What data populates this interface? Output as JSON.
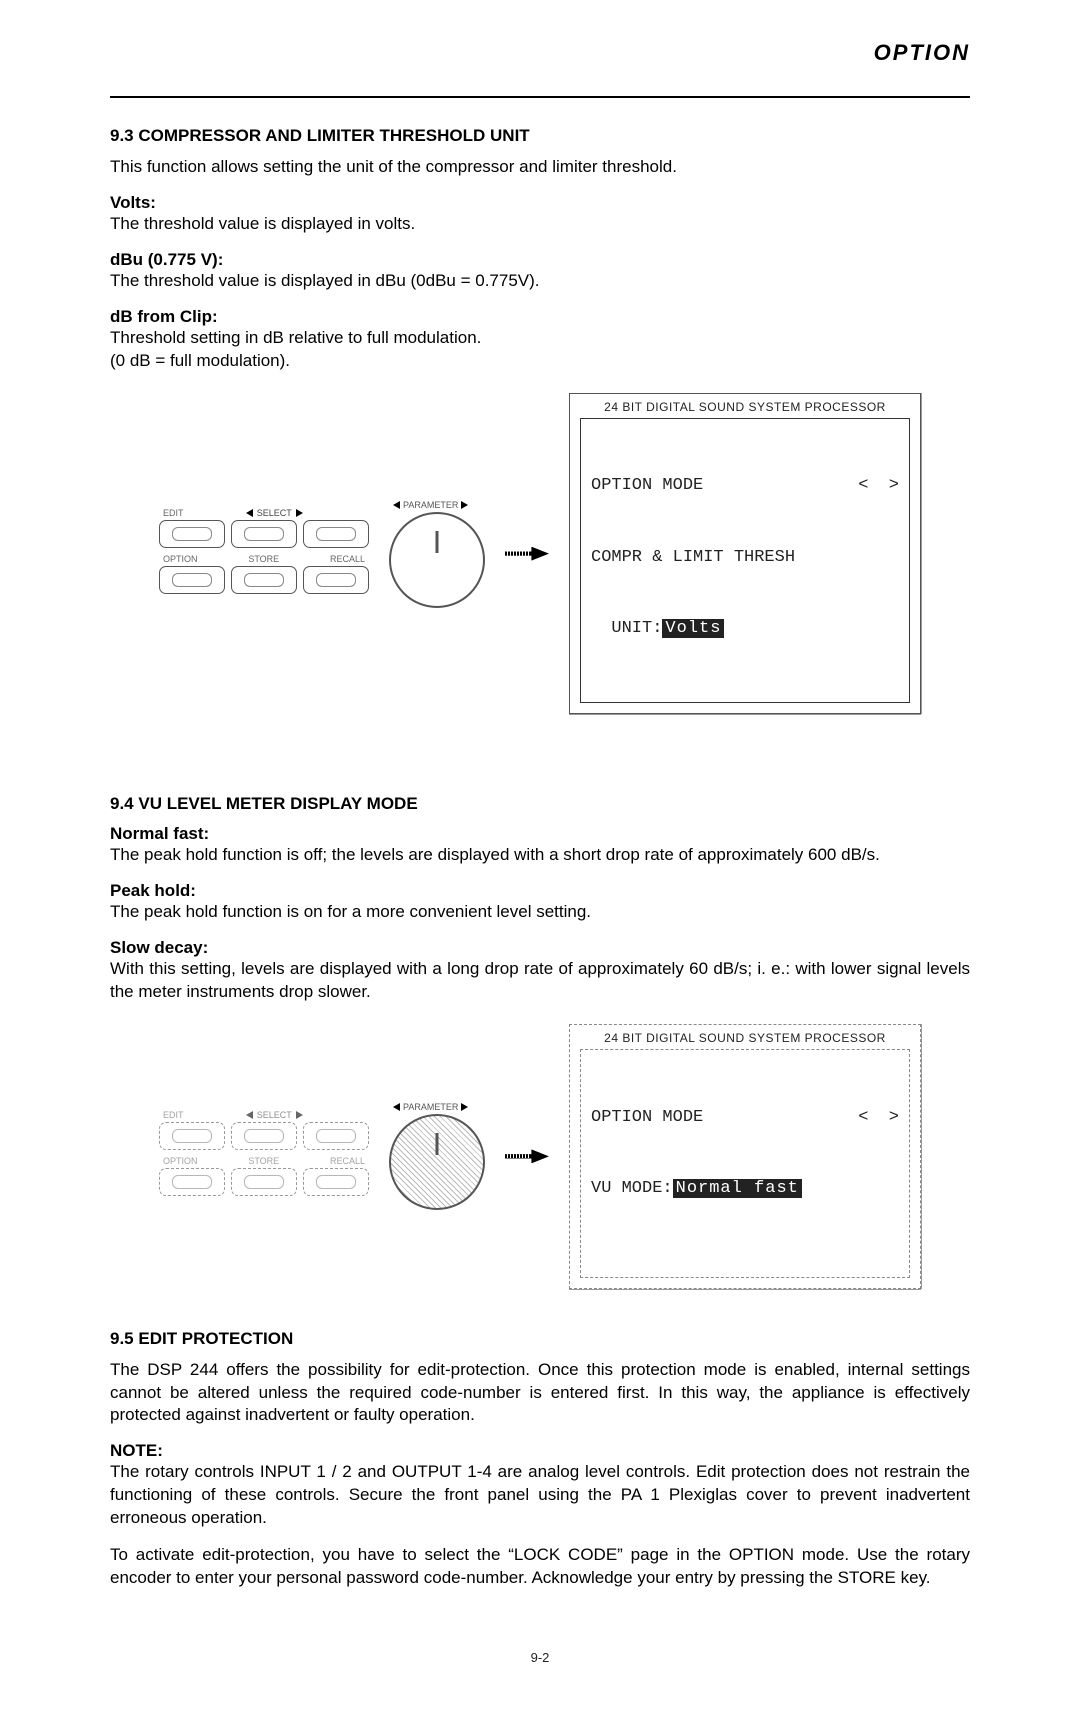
{
  "header": {
    "title": "OPTION"
  },
  "s93": {
    "heading": "9.3 COMPRESSOR AND LIMITER THRESHOLD UNIT",
    "intro": "This function allows setting the unit of the compressor and limiter threshold.",
    "volts_label": "Volts:",
    "volts_text": "The threshold value is displayed in volts.",
    "dbu_label": "dBu (0.775 V):",
    "dbu_text": "The threshold value is displayed in dBu (0dBu = 0.775V).",
    "dbclip_label": "dB from Clip:",
    "dbclip_text1": "Threshold setting in dB relative to full modulation.",
    "dbclip_text2": "(0 dB = full modulation)."
  },
  "panel": {
    "edit": "EDIT",
    "select": "SELECT",
    "option": "OPTION",
    "store": "STORE",
    "recall": "RECALL",
    "parameter": "PARAMETER"
  },
  "lcd1": {
    "title": "24 BIT DIGITAL SOUND SYSTEM PROCESSOR",
    "line1_left": "OPTION MODE",
    "line1_right": "<  >",
    "line2": "COMPR & LIMIT THRESH",
    "line3_prefix": "  UNIT:",
    "line3_value": "Volts"
  },
  "s94": {
    "heading": "9.4 VU LEVEL METER DISPLAY MODE",
    "nf_label": "Normal fast:",
    "nf_text": "The peak hold function is off; the levels are displayed with a short drop rate of approximately 600 dB/s.",
    "ph_label": "Peak hold:",
    "ph_text": "The peak hold function is on for a more convenient level setting.",
    "sd_label": "Slow decay:",
    "sd_text": "With this setting, levels are displayed with a long drop rate of approximately 60 dB/s; i. e.: with lower signal levels the meter instruments drop slower."
  },
  "lcd2": {
    "title": "24 BIT DIGITAL SOUND SYSTEM PROCESSOR",
    "line1_left": "OPTION MODE",
    "line1_right": "<  >",
    "line2_prefix": "VU MODE:",
    "line2_value": "Normal fast"
  },
  "s95": {
    "heading": "9.5  EDIT PROTECTION",
    "p1": "The DSP 244 offers the possibility for edit-protection. Once this protection mode is enabled, internal settings cannot be altered unless the required code-number is entered first. In this way, the appliance is effectively protected against inadvertent or faulty operation.",
    "note_label": "NOTE:",
    "note_text": "The rotary controls INPUT 1 / 2 and OUTPUT 1-4 are analog level controls. Edit protection does not restrain the functioning of these controls. Secure the front panel using the PA 1 Plexiglas cover to prevent inadvertent erroneous operation.",
    "p2": "To activate edit-protection, you have to select the “LOCK CODE” page in the OPTION mode. Use the rotary encoder to enter your personal password code-number. Acknowledge your entry by pressing the STORE key."
  },
  "pagenum": "9-2"
}
